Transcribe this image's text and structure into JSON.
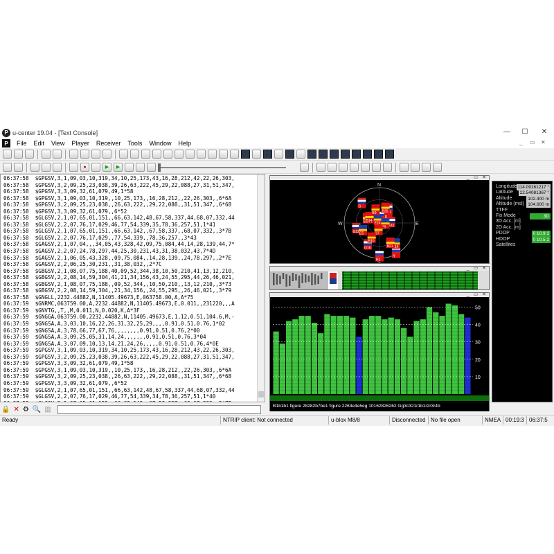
{
  "window": {
    "title": "u-center 19.04 - [Text Console]",
    "logo": "P",
    "minimize": "—",
    "maximize": "☐",
    "close": "✕"
  },
  "menu": {
    "items": [
      "File",
      "Edit",
      "View",
      "Player",
      "Receiver",
      "Tools",
      "Window",
      "Help"
    ],
    "mdi_buttons": [
      "_",
      "▭",
      "✕"
    ]
  },
  "console": {
    "lines": [
      "06:37:58  $GPGSV,3,1,09,03,10,319,34,10,25,173,43,16,28,212,42,22,26,303,",
      "06:37:58  $GPGSV,3,2,09,25,23,038,39,26,63,222,45,29,22,088,27,31,51,347,",
      "06:37:58  $GPGSV,3,3,09,32,61,079,49,1*58",
      "06:37:58  $GPGSV,3,1,09,03,10,319,,10,25,173,,16,28,212,,22,26,303,,6*6A",
      "06:37:58  $GPGSV,3,2,09,25,23,038,,26,63,222,,29,22,088,,31,51,347,,6*68",
      "06:37:58  $GPGSV,3,3,09,32,61,079,,6*52",
      "06:37:58  $GLGSV,2,1,07,65,01,151,,66,63,142,48,67,58,337,44,68,07,332,44",
      "06:37:58  $GLGSV,2,2,07,76,17,029,46,77,54,339,35,78,36,257,51,1*41",
      "06:37:58  $GLGSV,2,1,07,65,01,151,,66,63,142,,67,58,337,,68,07,332,,3*7B",
      "06:37:58  $GLGSV,2,2,07,76,17,029,,77,54,339,,78,36,257,,3*43",
      "06:37:58  $GAGSV,2,1,07,04,,,34,05,43,328,42,09,75,084,44,14,28,139,44,7*",
      "06:37:58  $GAGSV,2,2,07,24,78,297,44,25,30,231,43,31,38,032,43,7*4D",
      "06:37:58  $GAGSV,2,1,06,05,43,328,,09,75,084,,14,28,139,,24,78,297,,2*7E",
      "06:37:58  $GAGSV,2,2,06,25,30,231,,31,38,032,,2*7C",
      "06:37:58  $GBGSV,2,1,08,07,75,188,40,09,52,344,38,10,50,210,41,13,12,210,",
      "06:37:58  $GBGSV,2,2,08,14,59,304,41,21,34,156,43,24,55,295,44,26,46,021,",
      "06:37:58  $GBGSV,2,1,08,07,75,188,,09,52,344,,10,50,210,,13,12,210,,3*73",
      "06:37:58  $GBGSV,2,2,08,14,59,304,,21,34,156,,24,55,295,,26,46,021,,3*79",
      "06:37:58  $GNGLL,2232.44882,N,11405.49673,E,063758.00,A,A*75",
      "06:37:59  $GNRMC,063759.00,A,2232.44882,N,11405.49673,E,0.011,,231220,,,A",
      "06:37:59  $GNVTG,,T,,M,0.011,N,0.020,K,A*3F",
      "06:37:59  $GNGGA,063759.00,2232.44882,N,11405.49673,E,1,12,0.51,104.6,M,-",
      "06:37:59  $GNGSA,A,3,03,10,16,22,26,31,32,25,29,,,,0.91,0.51,0.76,1*02",
      "06:37:59  $GNGSA,A,3,78,66,77,67,76,,,,,,,,0.91,0.51,0.76,2*00",
      "06:37:59  $GNGSA,A,3,09,25,05,31,14,24,,,,,,,0.91,0.51,0.76,3*04",
      "06:37:59  $GNGSA,A,3,07,09,10,13,14,21,24,26,,,,,0.91,0.51,0.76,4*0E",
      "06:37:59  $GPGSV,3,1,09,03,10,319,34,10,25,173,43,16,28,212,43,22,26,303,",
      "06:37:59  $GPGSV,3,2,09,25,23,038,39,26,63,222,45,29,22,088,27,31,51,347,",
      "06:37:59  $GPGSV,3,3,09,32,61,079,49,1*58",
      "06:37:59  $GPGSV,3,1,09,03,10,319,,10,25,173,,16,28,212,,22,26,303,,6*6A",
      "06:37:59  $GPGSV,3,2,09,25,23,038,,26,63,222,,29,22,088,,31,51,347,,6*68",
      "06:37:59  $GPGSV,3,3,09,32,61,079,,6*52",
      "06:37:59  $GLGSV,2,1,07,65,01,151,,66,63,142,48,67,58,337,44,68,07,332,44",
      "06:37:59  $GLGSV,2,2,07,76,17,029,46,77,54,339,34,78,36,257,51,1*40",
      "06:37:59  $GLGSV,2,1,07,65,01,151,,66,63,142,,67,58,337,,68,07,332,,3*7B",
      "06:37:59  $GLGSV,2,2,07,76,17,029,,77,54,339,,78,36,257,,3*43",
      "06:37:59  $GAGSV,2,1,07,04,,,34,05,43,328,42,09,75,084,44,14,28,139,44,7*",
      "06:37:59  $GAGSV,2,2,07,24,78,297,44,25,30,231,43,31,38,032,43,7*4D",
      "06:37:59  $GAGSV,2,1,06,05,43,328,,09,75,084,,14,28,139,,24,78,297,,2*7E"
    ]
  },
  "skyview": {
    "compass": [
      "N",
      "E",
      "S",
      "W"
    ],
    "satellites": [
      {
        "label": "R",
        "az": 150,
        "el": 5,
        "flag": "ru"
      },
      {
        "label": "R",
        "az": 10,
        "el": 72,
        "flag": "ru"
      },
      {
        "label": "R",
        "az": 40,
        "el": 55,
        "flag": "ru"
      },
      {
        "label": "R1",
        "az": 180,
        "el": 8,
        "flag": "ru"
      },
      {
        "label": "G",
        "az": 320,
        "el": 20,
        "flag": "us"
      },
      {
        "label": "G26",
        "az": 300,
        "el": 60,
        "flag": "us"
      },
      {
        "label": "G31",
        "az": 30,
        "el": 45,
        "flag": "us"
      },
      {
        "label": "G32",
        "az": 80,
        "el": 60,
        "flag": "us"
      },
      {
        "label": "G16",
        "az": 210,
        "el": 30,
        "flag": "us"
      },
      {
        "label": "G22",
        "az": 260,
        "el": 30,
        "flag": "us"
      },
      {
        "label": "E24",
        "az": 340,
        "el": 78,
        "flag": "eu"
      },
      {
        "label": "E14",
        "az": 140,
        "el": 25,
        "flag": "eu"
      },
      {
        "label": "E5",
        "az": 250,
        "el": 45,
        "flag": "eu"
      },
      {
        "label": "E9",
        "az": 85,
        "el": 75,
        "flag": "eu"
      },
      {
        "label": "B7",
        "az": 190,
        "el": 75,
        "flag": "cn"
      },
      {
        "label": "B21",
        "az": 150,
        "el": 35,
        "flag": "cn"
      },
      {
        "label": "B24",
        "az": 295,
        "el": 55,
        "flag": "cn"
      },
      {
        "label": "B14",
        "az": 305,
        "el": 59,
        "flag": "cn"
      },
      {
        "label": "B10",
        "az": 210,
        "el": 50,
        "flag": "cn"
      },
      {
        "label": "B26",
        "az": 20,
        "el": 46,
        "flag": "cn"
      },
      {
        "label": "B9",
        "az": 345,
        "el": 52,
        "flag": "cn"
      }
    ]
  },
  "signal_chart": {
    "ylim": [
      0,
      55
    ],
    "yticks": [
      "50",
      "40",
      "30",
      "20",
      "10"
    ],
    "footer": "B1b1b1 figure 28282b7be1 figure 2263e4e5eg 10162826262 Gg3c321r1b1r2r3r4b",
    "bars": [
      {
        "v": 36,
        "c": "#3fc43f"
      },
      {
        "v": 29,
        "c": "#3fc43f"
      },
      {
        "v": 42,
        "c": "#3fc43f"
      },
      {
        "v": 43,
        "c": "#3fc43f"
      },
      {
        "v": 45,
        "c": "#3fc43f"
      },
      {
        "v": 45,
        "c": "#3fc43f"
      },
      {
        "v": 41,
        "c": "#3fc43f"
      },
      {
        "v": 35,
        "c": "#3fc43f"
      },
      {
        "v": 46,
        "c": "#3fc43f"
      },
      {
        "v": 45,
        "c": "#3fc43f"
      },
      {
        "v": 45,
        "c": "#3fc43f"
      },
      {
        "v": 45,
        "c": "#3fc43f"
      },
      {
        "v": 44,
        "c": "#3fc43f"
      },
      {
        "v": 33,
        "c": "#1f2fd6"
      },
      {
        "v": 43,
        "c": "#3fc43f"
      },
      {
        "v": 45,
        "c": "#3fc43f"
      },
      {
        "v": 45,
        "c": "#3fc43f"
      },
      {
        "v": 43,
        "c": "#3fc43f"
      },
      {
        "v": 44,
        "c": "#3fc43f"
      },
      {
        "v": 43,
        "c": "#3fc43f"
      },
      {
        "v": 38,
        "c": "#3fc43f"
      },
      {
        "v": 33,
        "c": "#3fc43f"
      },
      {
        "v": 42,
        "c": "#3fc43f"
      },
      {
        "v": 43,
        "c": "#3fc43f"
      },
      {
        "v": 50,
        "c": "#3fc43f"
      },
      {
        "v": 47,
        "c": "#3fc43f"
      },
      {
        "v": 45,
        "c": "#3fc43f"
      },
      {
        "v": 52,
        "c": "#3fc43f"
      },
      {
        "v": 51,
        "c": "#3fc43f"
      },
      {
        "v": 46,
        "c": "#3fc43f"
      },
      {
        "v": 44,
        "c": "#1f2fd6"
      }
    ]
  },
  "status_panel": {
    "rows": [
      {
        "label": "Longitude",
        "value": "114.09161217 °"
      },
      {
        "label": "Latitude",
        "value": "22.54081367 °"
      },
      {
        "label": "Altitude",
        "value": "102.400 m"
      },
      {
        "label": "Altitude (msl)",
        "value": "104.600 m"
      },
      {
        "label": "TTFF",
        "value": ""
      },
      {
        "label": "Fix Mode",
        "value": "3D"
      },
      {
        "label": "3D Acc. [m]",
        "value": ""
      },
      {
        "label": "2D Acc. [m]",
        "value": ""
      },
      {
        "label": "PDOP",
        "value": "0    10.9    2"
      },
      {
        "label": "HDOP",
        "value": "0    10.5    2"
      },
      {
        "label": "Satellites",
        "value": ""
      }
    ]
  },
  "statusbar": {
    "ready": "Ready",
    "ntrip": "NTRIP client: Not connected",
    "receiver": "u-blox M8/8",
    "connection": "Disconnected",
    "file": "No file open",
    "protocol": "NMEA",
    "time1": "00:19:3",
    "time2": "06:37:5"
  },
  "colors": {
    "accent_green": "#3fc43f",
    "accent_blue": "#1f2fd6",
    "panel_black": "#000000"
  }
}
